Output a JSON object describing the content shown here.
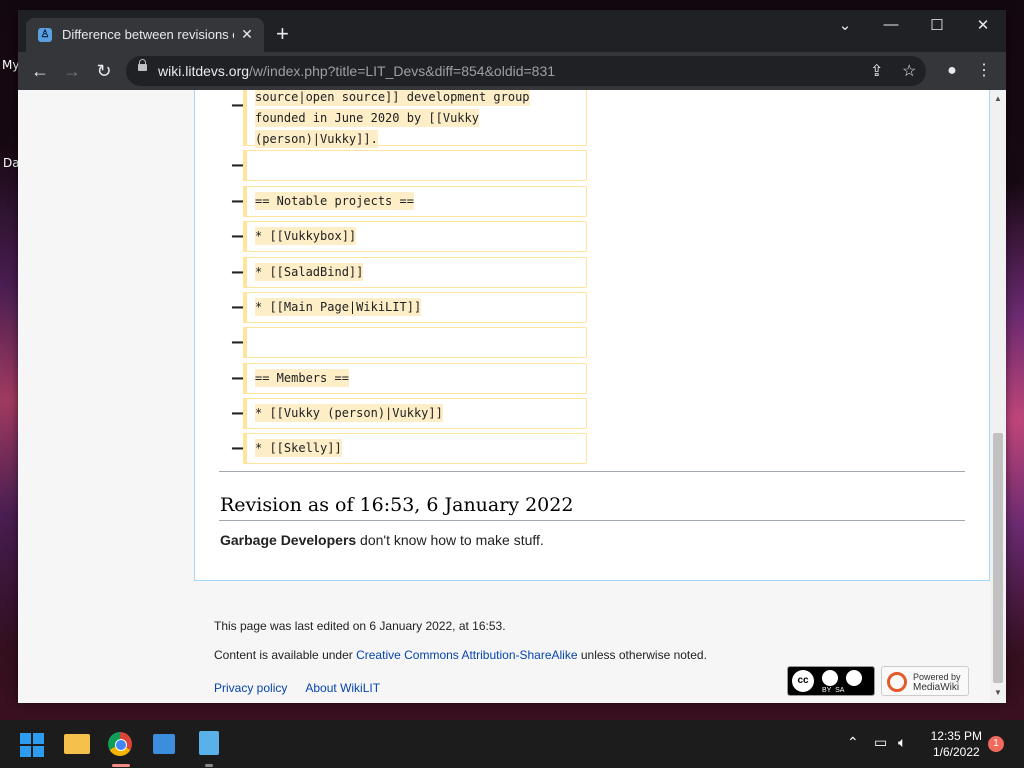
{
  "desktop": {
    "label_top": "My",
    "label_mid": "Da"
  },
  "browser": {
    "tab_title": "Difference between revisions of \"LIT Devs\" - WikiLIT",
    "tab_favicon": "wiki-favicon",
    "url_host": "wiki.litdevs.org",
    "url_path": "/w/index.php?title=LIT_Devs&diff=854&oldid=831",
    "window_controls": [
      "minimize",
      "maximize",
      "close"
    ]
  },
  "diff": {
    "first_lines": [
      "source|open source]] development group",
      "founded in June 2020 by [[Vukky",
      "(person)|Vukky]]."
    ],
    "rows": [
      "",
      "== Notable projects ==",
      "* [[Vukkybox]]",
      "* [[SaladBind]]",
      "* [[Main Page|WikiLIT]]",
      "",
      "== Members ==",
      "* [[Vukky (person)|Vukky]]",
      "* [[Skelly]]"
    ]
  },
  "revision": {
    "heading": "Revision as of 16:53, 6 January 2022",
    "bold": "Garbage Developers",
    "rest": " don't know how to make stuff."
  },
  "footer": {
    "last_edited": "This page was last edited on 6 January 2022, at 16:53.",
    "license_prefix": "Content is available under ",
    "license_link": "Creative Commons Attribution-ShareAlike",
    "license_suffix": " unless otherwise noted.",
    "privacy": "Privacy policy",
    "about": "About WikiLIT",
    "cc_badge": "BY  SA",
    "mw_badge_line1": "Powered by",
    "mw_badge_line2": "MediaWiki"
  },
  "taskbar": {
    "time": "12:35 PM",
    "date": "1/6/2022",
    "notifications": "1"
  },
  "colors": {
    "link": "#0645ad",
    "diff_border": "#ffe49c",
    "diff_highlight": "#feeec8",
    "content_border": "#a7d7f9"
  }
}
